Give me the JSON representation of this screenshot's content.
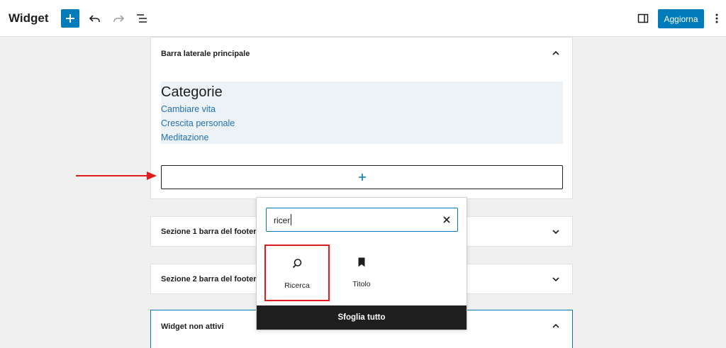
{
  "header": {
    "title": "Widget",
    "update_label": "Aggiorna"
  },
  "main_sidebar": {
    "title": "Barra laterale principale",
    "categories_title": "Categorie",
    "categories": [
      "Cambiare vita",
      "Crescita personale",
      "Meditazione"
    ]
  },
  "footer_sections": [
    {
      "title": "Sezione 1 barra del footer"
    },
    {
      "title": "Sezione 2 barra del footer"
    }
  ],
  "inactive_widgets": {
    "title": "Widget non attivi"
  },
  "inserter": {
    "search_value": "ricer",
    "results": [
      {
        "label": "Ricerca",
        "icon": "search-icon"
      },
      {
        "label": "Titolo",
        "icon": "bookmark-icon"
      }
    ],
    "browse_all_label": "Sfoglia tutto"
  },
  "colors": {
    "accent": "#007cba",
    "link": "#2271b1",
    "highlight_red": "#e01b1b",
    "category_bg": "#edf2f7"
  }
}
